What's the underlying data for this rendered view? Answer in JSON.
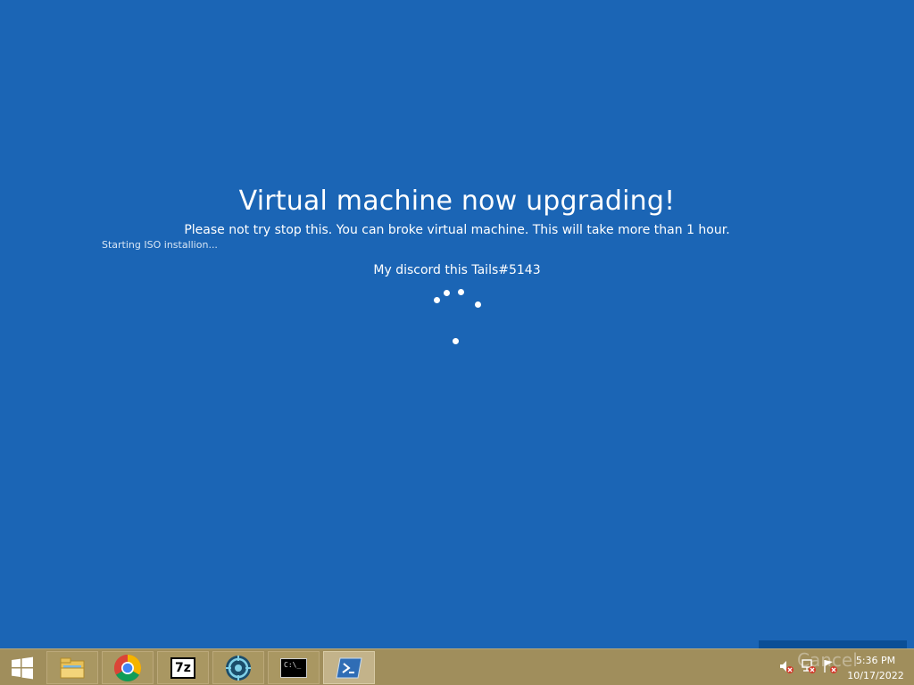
{
  "screen": {
    "headline": "Virtual machine now upgrading!",
    "subline": "Please not try stop this. You can broke virtual machine. This will take more than 1 hour.",
    "status": "Starting ISO installion...",
    "discord": "My discord this Tails#5143"
  },
  "overlay": {
    "cancel_label": "Cancel"
  },
  "taskbar": {
    "start_icon": "windows-logo-icon",
    "pinned": [
      {
        "name": "file-explorer",
        "icon": "folder-icon"
      },
      {
        "name": "chrome",
        "icon": "chrome-icon"
      },
      {
        "name": "7zip",
        "icon": "7zip-icon"
      },
      {
        "name": "target-app",
        "icon": "target-icon"
      },
      {
        "name": "command-prompt",
        "icon": "cmd-icon",
        "glyph": "C:\\_"
      },
      {
        "name": "powershell",
        "icon": "powershell-icon",
        "active": true
      }
    ],
    "sevenzip_label": "7z",
    "tray": {
      "icons": [
        "speaker-muted-icon",
        "network-error-icon",
        "action-center-flag-icon"
      ],
      "time": "5:36 PM",
      "date": "10/17/2022"
    }
  },
  "colors": {
    "background": "#1b65b5",
    "taskbar": "#a08e5c",
    "text": "#ffffff"
  }
}
